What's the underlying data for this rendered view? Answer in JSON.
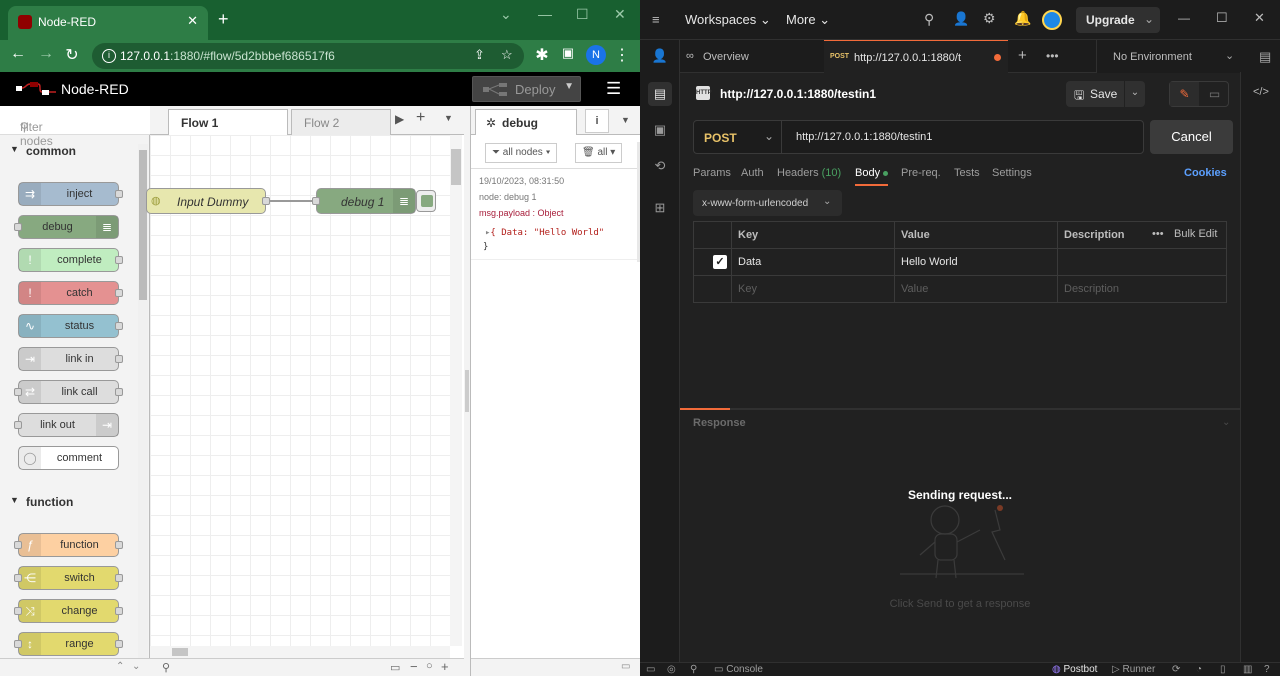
{
  "browser": {
    "tab_title": "Node-RED",
    "url_host": "127.0.0.1",
    "url_rest": ":1880/#flow/5d2bbbef686517f6",
    "profile_initial": "N"
  },
  "nodered": {
    "title": "Node-RED",
    "deploy_label": "Deploy",
    "filter_placeholder": "filter nodes",
    "categories": [
      "common",
      "function"
    ],
    "palette_nodes": [
      {
        "label": "inject",
        "color": "#a6bbcf"
      },
      {
        "label": "debug",
        "color": "#87a980"
      },
      {
        "label": "complete",
        "color": "#c0edc0"
      },
      {
        "label": "catch",
        "color": "#e49191"
      },
      {
        "label": "status",
        "color": "#94c1d0"
      },
      {
        "label": "link in",
        "color": "#dddddd"
      },
      {
        "label": "link call",
        "color": "#dddddd"
      },
      {
        "label": "link out",
        "color": "#dddddd"
      },
      {
        "label": "comment",
        "color": "#ffffff"
      },
      {
        "label": "function",
        "color": "#fdd0a2"
      },
      {
        "label": "switch",
        "color": "#e2d96e"
      },
      {
        "label": "change",
        "color": "#e2d96e"
      },
      {
        "label": "range",
        "color": "#e2d96e"
      }
    ],
    "flow_tabs": [
      "Flow 1",
      "Flow 2"
    ],
    "canvas_nodes": [
      {
        "label": "Input Dummy",
        "color": "#e7e7ae"
      },
      {
        "label": "debug 1",
        "color": "#87a980"
      }
    ],
    "sidebar_tab": "debug",
    "filter_nodes_label": "all nodes",
    "clear_label": "all",
    "debug_message": {
      "timestamp": "19/10/2023, 08:31:50",
      "node": "node: debug 1",
      "type": "msg.payload : Object",
      "payload_open": "{ Data: \"Hello World\"",
      "payload_close": "}"
    }
  },
  "postman": {
    "workspaces_label": "Workspaces",
    "more_label": "More",
    "upgrade_label": "Upgrade",
    "overview_tab": "Overview",
    "active_tab_method": "POST",
    "active_tab_url": "http://127.0.0.1:1880/t",
    "environment": "No Environment",
    "request_name": "http://127.0.0.1:1880/testin1",
    "save_label": "Save",
    "method": "POST",
    "url": "http://127.0.0.1:1880/testin1",
    "cancel_label": "Cancel",
    "request_tabs": [
      {
        "label": "Params"
      },
      {
        "label": "Auth"
      },
      {
        "label": "Headers",
        "count": "(10)"
      },
      {
        "label": "Body"
      },
      {
        "label": "Pre-req."
      },
      {
        "label": "Tests"
      },
      {
        "label": "Settings"
      }
    ],
    "cookies_label": "Cookies",
    "body_type": "x-www-form-urlencoded",
    "table_headers": {
      "key": "Key",
      "value": "Value",
      "description": "Description",
      "bulk_edit": "Bulk Edit"
    },
    "rows": [
      {
        "key": "Data",
        "value": "Hello World",
        "description": ""
      }
    ],
    "placeholder_row": {
      "key": "Key",
      "value": "Value",
      "description": "Description"
    },
    "response_label": "Response",
    "sending_text": "Sending request...",
    "hint_text": "Click Send to get a response",
    "status_bar": {
      "console": "Console",
      "postbot": "Postbot",
      "runner": "Runner"
    },
    "accent_color": "#f26b3a"
  }
}
